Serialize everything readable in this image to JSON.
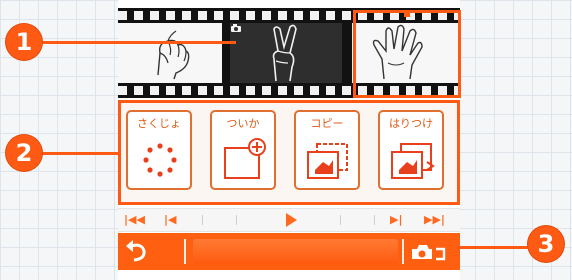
{
  "markers": [
    {
      "number": "1",
      "target": "selected-frame"
    },
    {
      "number": "2",
      "target": "edit-tools"
    },
    {
      "number": "3",
      "target": "camera-button"
    }
  ],
  "tools": [
    {
      "label": "さくじょ",
      "icon": "delete-dots-icon"
    },
    {
      "label": "ついか",
      "icon": "add-frame-icon"
    },
    {
      "label": "コピー",
      "icon": "copy-frames-icon"
    },
    {
      "label": "はりつけ",
      "icon": "paste-frame-icon"
    }
  ],
  "timeline": {
    "first_label": "|◀◀",
    "prev_label": "|◀",
    "next_label": "▶|",
    "last_label": "▶▶|"
  },
  "bottombar": {
    "back_icon": "back-arrow-icon",
    "camera_icon": "camera-icon"
  },
  "colors": {
    "accent": "#ff5a14",
    "icon_red": "#e8401c",
    "bar": "#ff5f10"
  }
}
